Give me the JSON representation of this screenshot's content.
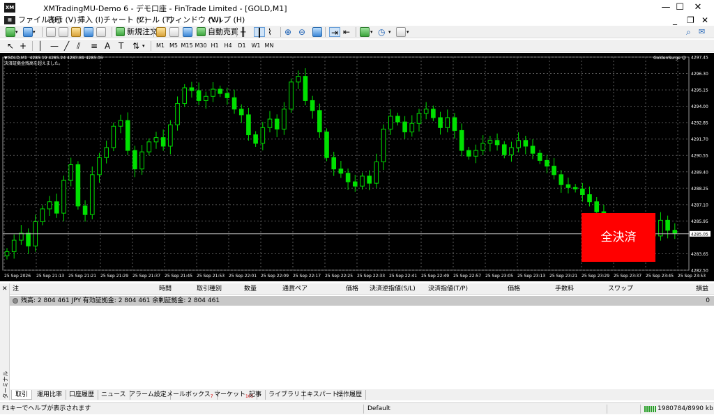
{
  "window": {
    "title": "XMTradingMU-Demo 6 - デモ口座 - FinTrade Limited - [GOLD,M1]",
    "app_icon": "XM",
    "controls": [
      "—",
      "☐",
      "✕"
    ]
  },
  "menu": {
    "items": [
      "ファイル (F)",
      "表示 (V)",
      "挿入 (I)",
      "チャート (C)",
      "ツール (T)",
      "ウィンドウ (W)",
      "ヘルプ (H)"
    ],
    "mdi_controls": [
      "_",
      "❐",
      "✕"
    ]
  },
  "toolbar1": {
    "new_order_label": "新規注文",
    "auto_trading_label": "自動売買"
  },
  "toolbar2": {
    "timeframes": [
      "M1",
      "M5",
      "M15",
      "M30",
      "H1",
      "H4",
      "D1",
      "W1",
      "MN"
    ]
  },
  "chart": {
    "info_line": "▼GOLD,M1  4285.19 4285.24 4283.89 4285.05",
    "info_line2": "決済証拠金残高を超えました。",
    "indicator_label": "GoldenSurge ☺",
    "current_price_label": "4285.05",
    "close_all_label": "全決済",
    "colors": {
      "background": "#000000",
      "candle": "#00e000",
      "grid": "#5a5a5a",
      "axis_text": "#ffffff"
    }
  },
  "chart_data": {
    "type": "candlestick",
    "symbol": "GOLD",
    "timeframe": "M1",
    "ylim": [
      4282.5,
      4297.45
    ],
    "y_ticks": [
      "4297.45",
      "4296.30",
      "4295.15",
      "4294.00",
      "4292.85",
      "4291.70",
      "4290.55",
      "4289.40",
      "4288.25",
      "4287.10",
      "4285.95",
      "4285.05",
      "4283.65",
      "4282.50"
    ],
    "x_ticks": [
      "25 Sep 2026",
      "25 Sep 21:13",
      "25 Sep 21:21",
      "25 Sep 21:29",
      "25 Sep 21:37",
      "25 Sep 21:45",
      "25 Sep 21:53",
      "25 Sep 22:01",
      "25 Sep 22:09",
      "25 Sep 22:17",
      "25 Sep 22:25",
      "25 Sep 22:33",
      "25 Sep 22:41",
      "25 Sep 22:49",
      "25 Sep 22:57",
      "25 Sep 23:05",
      "25 Sep 23:13",
      "25 Sep 23:21",
      "25 Sep 23:29",
      "25 Sep 23:37",
      "25 Sep 23:45",
      "25 Sep 23:53"
    ],
    "close_series": [
      4283.8,
      4284.6,
      4285.1,
      4284.2,
      4285.9,
      4286.8,
      4287.3,
      4286.5,
      4288.8,
      4289.9,
      4287.0,
      4286.4,
      4289.2,
      4290.4,
      4291.1,
      4292.6,
      4293.0,
      4290.9,
      4289.6,
      4290.8,
      4291.5,
      4291.8,
      4291.2,
      4292.7,
      4294.2,
      4295.3,
      4295.1,
      4294.4,
      4294.7,
      4295.2,
      4294.9,
      4294.6,
      4293.8,
      4293.4,
      4292.0,
      4291.4,
      4292.5,
      4293.1,
      4292.4,
      4293.8,
      4295.7,
      4296.1,
      4294.4,
      4293.7,
      4292.2,
      4290.4,
      4289.6,
      4289.3,
      4288.7,
      4288.4,
      4289.1,
      4288.6,
      4290.1,
      4292.4,
      4293.3,
      4292.9,
      4292.2,
      4292.8,
      4293.5,
      4293.8,
      4293.2,
      4292.5,
      4293.2,
      4292.3,
      4290.9,
      4290.5,
      4290.9,
      4291.4,
      4291.6,
      4291.3,
      4290.6,
      4291.1,
      4291.6,
      4291.2,
      4290.7,
      4290.2,
      4289.8,
      4289.2,
      4288.5,
      4288.3,
      4288.2,
      4287.8,
      4287.3,
      4286.6,
      4286.1,
      4285.6,
      4285.3,
      4285.5,
      4285.1,
      4285.8,
      4285.0,
      4284.9,
      4286.0,
      4285.3,
      4285.1
    ]
  },
  "terminal": {
    "side_label": "ターミナル",
    "columns": [
      "注",
      "時間",
      "取引種別",
      "数量",
      "通貨ペア",
      "価格",
      "決済逆指値(S/L)",
      "決済指値(T/P)",
      "価格",
      "手数料",
      "スワップ",
      "損益"
    ],
    "balance_text": "残高: 2 804 461 JPY  有効証拠金: 2 804 461  余剰証拠金: 2 804 461",
    "balance_value": "0",
    "tabs": [
      {
        "label": "取引",
        "badge": ""
      },
      {
        "label": "運用比率",
        "badge": ""
      },
      {
        "label": "口座履歴",
        "badge": ""
      },
      {
        "label": "ニュース",
        "badge": ""
      },
      {
        "label": "アラーム設定",
        "badge": ""
      },
      {
        "label": "メールボックス",
        "badge": "7"
      },
      {
        "label": "マーケット",
        "badge": "105"
      },
      {
        "label": "記事",
        "badge": ""
      },
      {
        "label": "ライブラリ",
        "badge": ""
      },
      {
        "label": "エキスパート",
        "badge": ""
      },
      {
        "label": "操作履歴",
        "badge": ""
      }
    ]
  },
  "status": {
    "help_text": "F1キーでヘルプが表示されます",
    "profile": "Default",
    "traffic": "1980784/8990 kb"
  }
}
